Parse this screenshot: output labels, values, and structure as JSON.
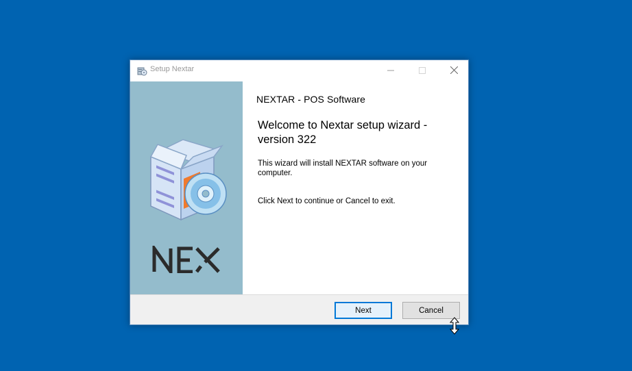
{
  "window": {
    "title": "Setup Nextar",
    "controls": {
      "minimize": "minimize-icon",
      "maximize": "maximize-icon",
      "close": "close-icon"
    }
  },
  "side_panel": {
    "icon": "software-box-cd-icon",
    "logo_text": "NEX"
  },
  "content": {
    "product_title": "NEXTAR - POS Software",
    "welcome_title": "Welcome to Nextar setup wizard - version 322",
    "description": "This wizard will install NEXTAR software on your computer.",
    "hint": "Click Next to continue or Cancel to exit."
  },
  "footer": {
    "next_label": "Next",
    "cancel_label": "Cancel"
  },
  "colors": {
    "desktop": "#0063b1",
    "side_panel": "#94bccc",
    "default_button_border": "#0078d7"
  },
  "cursor": "resize-vertical-cursor"
}
